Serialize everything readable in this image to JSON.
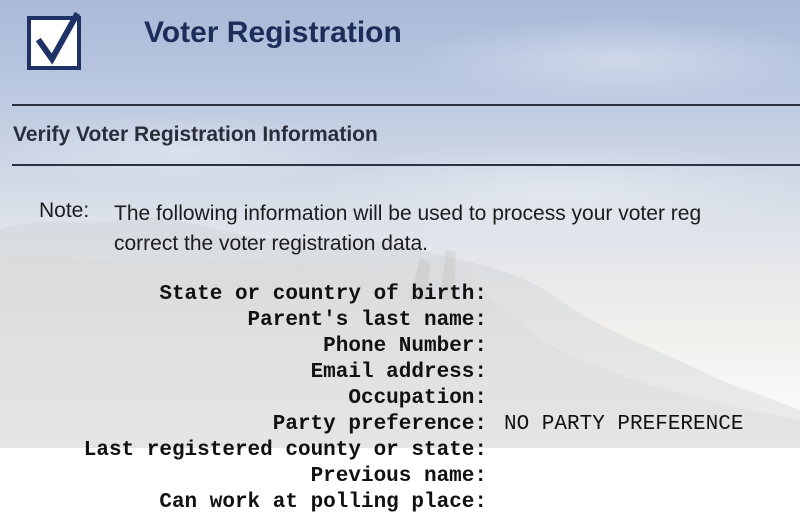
{
  "header": {
    "title": "Voter Registration",
    "logo_icon": "checkbox-check-icon"
  },
  "section": {
    "title": "Verify Voter Registration Information"
  },
  "note": {
    "label": "Note:",
    "line1": "The following information will be used to process your voter reg",
    "line2": "correct the voter registration data."
  },
  "fields": [
    {
      "label": "State or country of birth:",
      "value": ""
    },
    {
      "label": "Parent's last name:",
      "value": ""
    },
    {
      "label": "Phone Number:",
      "value": ""
    },
    {
      "label": "Email address:",
      "value": ""
    },
    {
      "label": "Occupation:",
      "value": ""
    },
    {
      "label": "Party preference:",
      "value": "NO PARTY PREFERENCE"
    },
    {
      "label": "Last registered county or state:",
      "value": ""
    },
    {
      "label": "Previous name:",
      "value": ""
    },
    {
      "label": "Can work at polling place:",
      "value": ""
    }
  ],
  "colors": {
    "title": "#1c2d5a",
    "logo_border": "#1f3266",
    "rule": "#2b3140"
  }
}
